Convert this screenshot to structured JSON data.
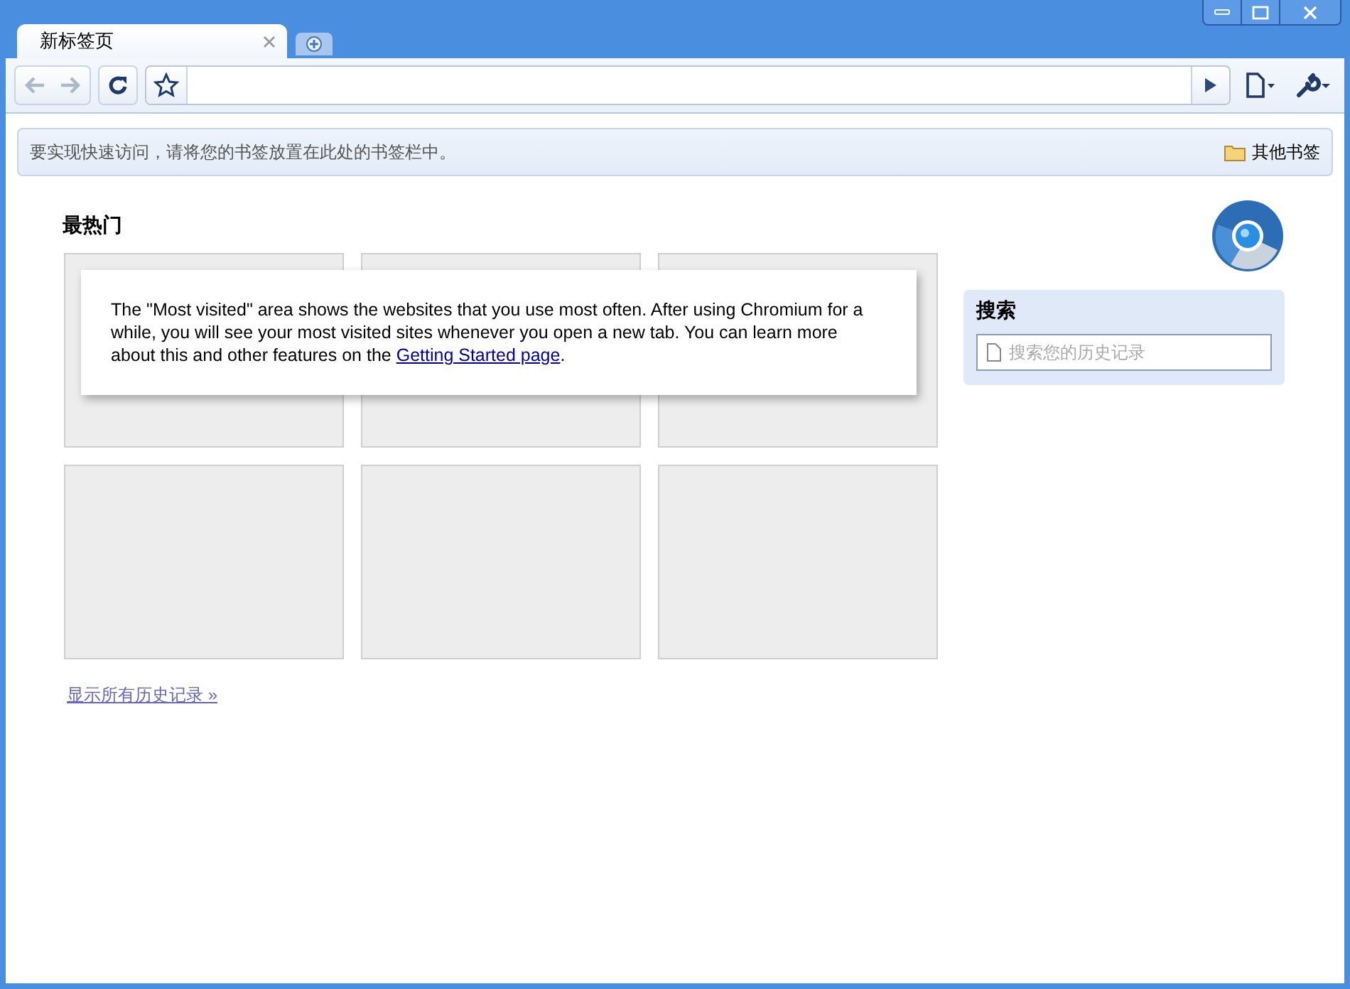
{
  "tabs": [
    {
      "label": "新标签页",
      "selected": true
    }
  ],
  "bookmarks_bar": {
    "hint": "要实现快速访问，请将您的书签放置在此处的书签栏中。",
    "other_bookmarks": "其他书签"
  },
  "most_visited": {
    "title": "最热门",
    "thumbnails": [
      {
        "kind": "blank"
      },
      {
        "kind": "blank"
      },
      {
        "kind": "blank"
      },
      {
        "kind": "blank"
      },
      {
        "kind": "blank"
      },
      {
        "kind": "blank"
      }
    ],
    "notice": {
      "text": "The \"Most visited\" area shows the websites that you use most often. After using Chromium for a while, you will see your most visited sites whenever you open a new tab. You can learn more about this and other features on the ",
      "link": "Getting Started page",
      "end": "."
    },
    "history_link": "显示所有历史记录 »"
  },
  "search": {
    "title": "搜索",
    "placeholder": "搜索您的历史记录"
  }
}
